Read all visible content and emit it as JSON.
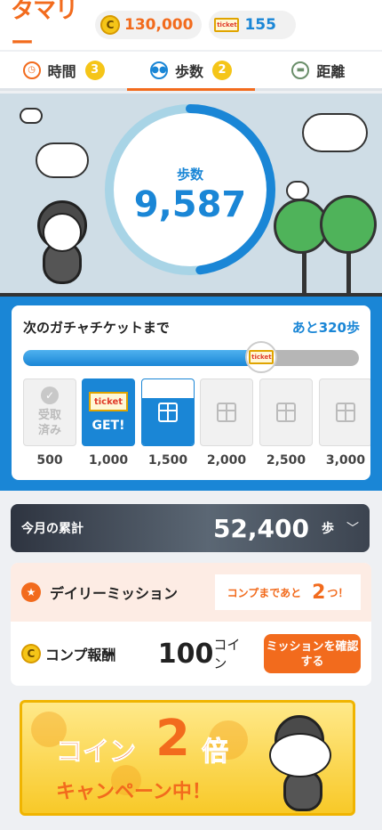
{
  "header": {
    "logo": "タマリー",
    "coins": "130,000",
    "tickets": "155",
    "ticket_icon_text": "ticket",
    "coin_icon_text": "C"
  },
  "tabs": [
    {
      "label": "時間",
      "badge": "3",
      "icon": "clock-icon"
    },
    {
      "label": "歩数",
      "badge": "2",
      "icon": "footsteps-icon"
    },
    {
      "label": "距離",
      "badge": "",
      "icon": "car-icon"
    }
  ],
  "hero": {
    "label": "歩数",
    "steps": "9,587",
    "progress": 0.48
  },
  "gacha": {
    "title": "次のガチャチケットまで",
    "remaining": "あと320歩",
    "progress": 0.71,
    "milestones": [
      {
        "label": "500",
        "state": "done",
        "text": "受取\n済み"
      },
      {
        "label": "1,000",
        "state": "get",
        "text": "GET!",
        "ticket": "ticket"
      },
      {
        "label": "1,500",
        "state": "partial"
      },
      {
        "label": "2,000",
        "state": "locked"
      },
      {
        "label": "2,500",
        "state": "locked"
      },
      {
        "label": "3,000",
        "state": "locked"
      }
    ]
  },
  "monthly": {
    "label": "今月の累計",
    "value": "52,400",
    "unit": "歩"
  },
  "mission": {
    "title": "デイリーミッション",
    "comp_text": "コンプまであと",
    "comp_count": "2",
    "comp_suffix": "つ！",
    "reward_label": "コンプ報酬",
    "reward_value": "100",
    "reward_unit": "コイン",
    "button": "ミッションを確認する"
  },
  "banner": {
    "line1": "コイン",
    "number": "2",
    "line1b": "倍",
    "line2": "キャンペーン中！"
  },
  "colors": {
    "accent": "#f26b1d",
    "blue": "#1a86d6"
  }
}
